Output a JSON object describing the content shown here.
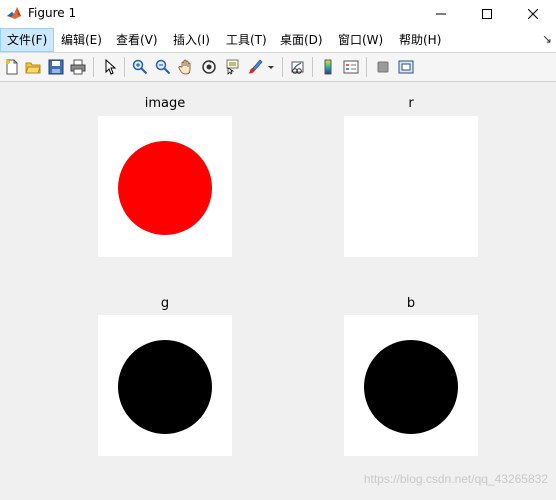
{
  "window": {
    "title": "Figure 1"
  },
  "menubar": {
    "items": [
      {
        "label": "文件(F)"
      },
      {
        "label": "编辑(E)"
      },
      {
        "label": "查看(V)"
      },
      {
        "label": "插入(I)"
      },
      {
        "label": "工具(T)"
      },
      {
        "label": "桌面(D)"
      },
      {
        "label": "窗口(W)"
      },
      {
        "label": "帮助(H)"
      }
    ],
    "active_index": 0,
    "overflow_arrow": "↘"
  },
  "toolbar": {
    "icons": [
      "new-figure-icon",
      "open-file-icon",
      "save-icon",
      "print-icon",
      "select-pointer-icon",
      "zoom-in-icon",
      "zoom-out-icon",
      "pan-hand-icon",
      "rotate-3d-icon",
      "data-cursor-icon",
      "brush-icon",
      "link-plot-icon",
      "colorbar-icon",
      "legend-icon",
      "hide-plot-tools-icon",
      "show-plot-tools-icon"
    ]
  },
  "subplots": [
    {
      "title": "image",
      "circle_color": "#ff0000"
    },
    {
      "title": "r",
      "circle_color": "#ffffff"
    },
    {
      "title": "g",
      "circle_color": "#000000"
    },
    {
      "title": "b",
      "circle_color": "#000000"
    }
  ],
  "watermark": "https://blog.csdn.net/qq_43265832",
  "colors": {
    "window_bg": "#f0f0f0",
    "axes_bg": "#ffffff",
    "menu_active_bg": "#cce8ff"
  }
}
